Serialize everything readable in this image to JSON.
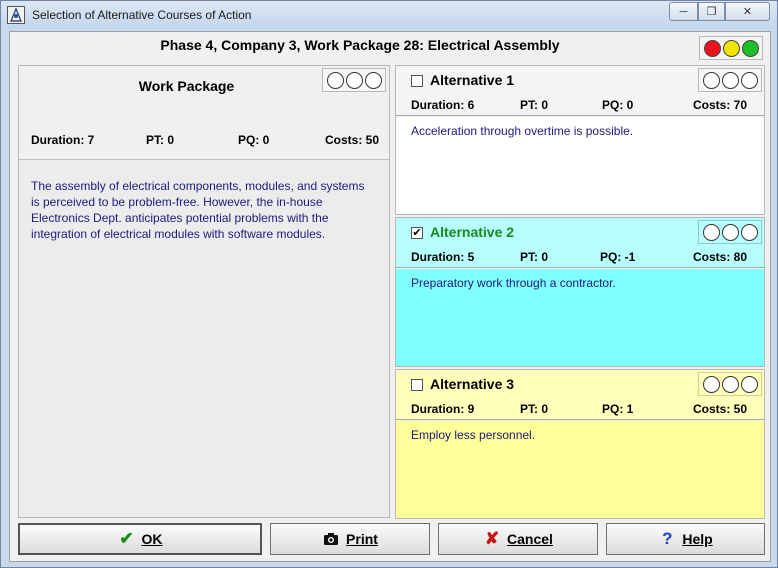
{
  "window": {
    "title": "Selection of Alternative Courses of Action"
  },
  "header": {
    "title": "Phase 4, Company 3, Work Package 28: Electrical Assembly",
    "traffic_lights": [
      "#e8141b",
      "#f0e400",
      "#1fbf2a"
    ]
  },
  "work_package": {
    "title": "Work Package",
    "duration": "Duration: 7",
    "pt": "PT: 0",
    "pq": "PQ: 0",
    "costs": "Costs: 50",
    "description": "The assembly of electrical components, modules, and systems is perceived to be problem-free. However, the in-house Electronics Dept. anticipates potential problems with the integration of electrical modules with software modules."
  },
  "alternatives": [
    {
      "title": "Alternative 1",
      "checked": false,
      "checkmark": "",
      "duration": "Duration: 6",
      "pt": "PT: 0",
      "pq": "PQ: 0",
      "costs": "Costs: 70",
      "description": "Acceleration through overtime is possible."
    },
    {
      "title": "Alternative 2",
      "checked": true,
      "checkmark": "✔",
      "duration": "Duration: 5",
      "pt": "PT: 0",
      "pq": "PQ: -1",
      "costs": "Costs: 80",
      "description": "Preparatory work through a contractor."
    },
    {
      "title": "Alternative 3",
      "checked": false,
      "checkmark": "",
      "duration": "Duration: 9",
      "pt": "PT: 0",
      "pq": "PQ: 1",
      "costs": "Costs: 50",
      "description": "Employ less personnel."
    }
  ],
  "buttons": {
    "ok": {
      "label": "OK",
      "icon": "checkmark-icon",
      "color": "#1a8a1a"
    },
    "print": {
      "label": "Print",
      "icon": "camera-icon"
    },
    "cancel": {
      "label": "Cancel",
      "icon": "x-icon",
      "color": "#c81414"
    },
    "help": {
      "label": "Help",
      "icon": "question-icon",
      "color": "#2040c0"
    }
  }
}
